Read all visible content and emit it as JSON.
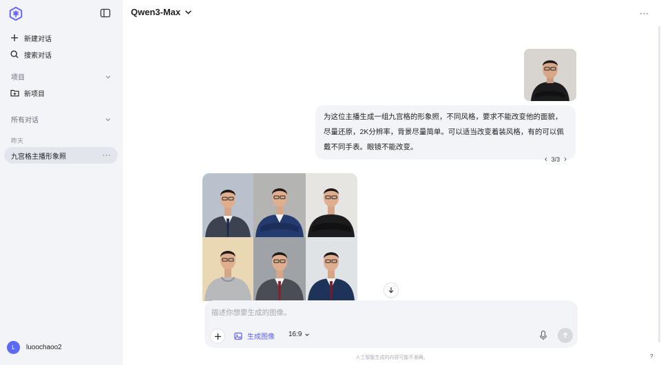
{
  "sidebar": {
    "new_chat": "新建对话",
    "search_chat": "搜索对话",
    "projects_heading": "项目",
    "new_project": "新项目",
    "all_chats_heading": "所有对话",
    "day_label": "昨天",
    "chat_items": [
      {
        "title": "九宫格主播形象照"
      }
    ],
    "user": {
      "initial": "L",
      "name": "luoochaoo2"
    }
  },
  "header": {
    "model": "Qwen3-Max"
  },
  "conversation": {
    "user_message": "为这位主播生成一组九宫格的形象照，不同风格，要求不能改变他的面貌，尽量还原，2K分辨率，背景尽量简单。可以适当改变着装风格，有的可以佩戴不同手表。眼镜不能改变。",
    "pager": "3/3"
  },
  "composer": {
    "placeholder": "描述你想要生成的图像。",
    "generate_image_label": "生成图像",
    "ratio": "16:9"
  },
  "footer": {
    "disclaimer": "人工智能生成的内容可能不准确。",
    "help": "?"
  },
  "colors": {
    "accent": "#5b5ff5",
    "sidebar_bg": "#f3f4f8"
  }
}
